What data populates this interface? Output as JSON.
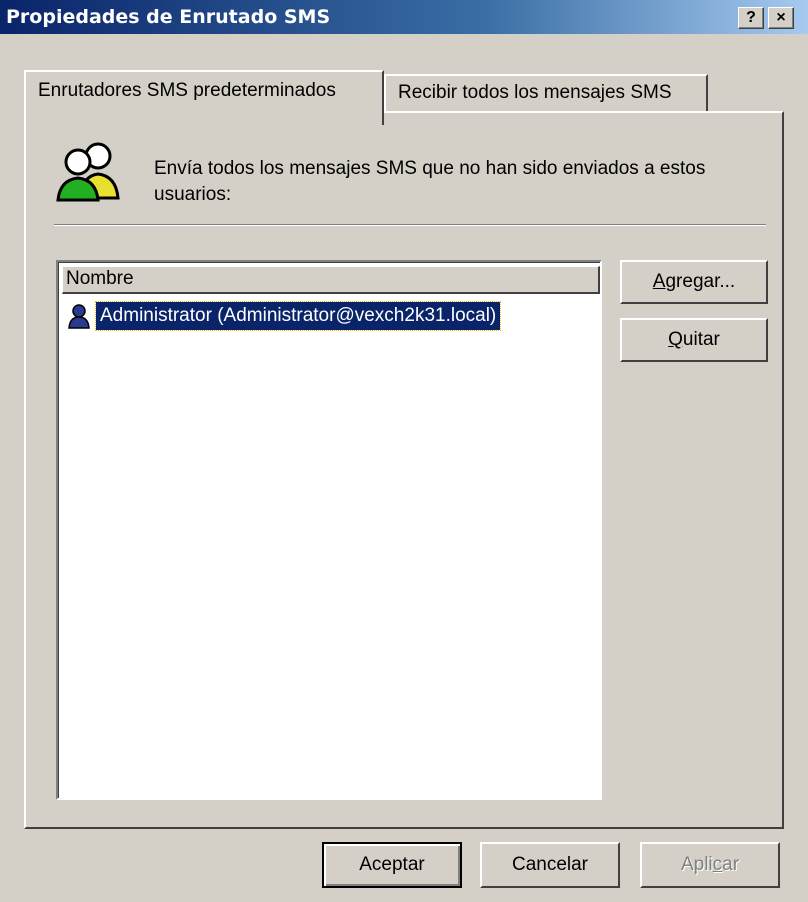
{
  "window": {
    "title": "Propiedades de Enrutado SMS",
    "help_glyph": "?",
    "close_glyph": "×"
  },
  "tabs": [
    {
      "label": "Enrutadores SMS predeterminados",
      "active": true
    },
    {
      "label": "Recibir todos los mensajes SMS",
      "active": false
    }
  ],
  "section": {
    "icon": "users-icon",
    "description": "Envía todos los mensajes SMS que no han sido enviados a estos usuarios:"
  },
  "list": {
    "column_header": "Nombre",
    "items": [
      {
        "icon": "user-icon",
        "label": "Administrator (Administrator@vexch2k31.local)",
        "selected": true
      }
    ]
  },
  "side_buttons": {
    "add": {
      "pre": "",
      "mnemonic": "A",
      "post": "gregar..."
    },
    "remove": {
      "pre": "",
      "mnemonic": "Q",
      "post": "uitar"
    }
  },
  "footer_buttons": {
    "ok": "Aceptar",
    "cancel": "Cancelar",
    "apply": {
      "pre": "Apli",
      "mnemonic": "c",
      "post": "ar",
      "disabled": true
    }
  },
  "colors": {
    "titlebar_start": "#0a246a",
    "titlebar_end": "#a6caf0",
    "selection": "#0a246a",
    "face": "#d4d0c8"
  }
}
